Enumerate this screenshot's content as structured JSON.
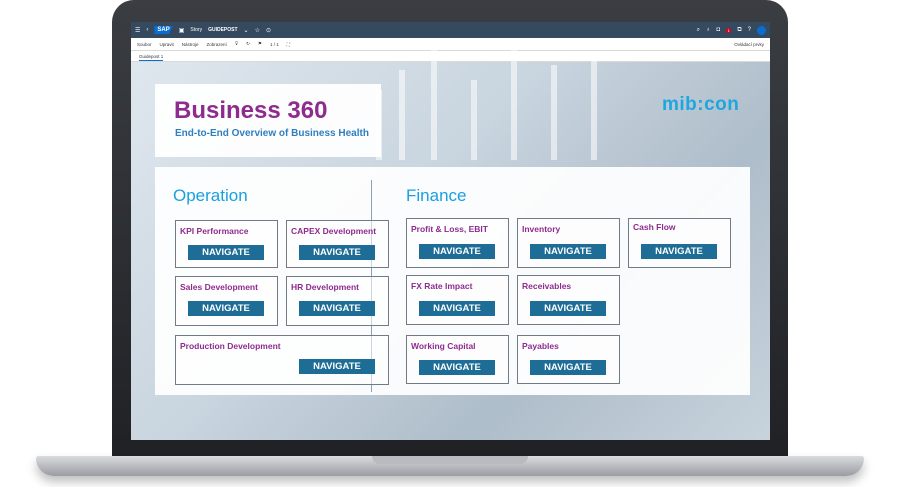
{
  "shell": {
    "logo": "SAP",
    "app": "Story",
    "story_name": "GUIDEPOST",
    "notification_count": "1",
    "icons": [
      "menu-icon",
      "back-icon",
      "story-icon",
      "star-icon",
      "edit-icon",
      "search-icon",
      "lightbulb-icon",
      "bell-icon",
      "copy-icon",
      "help-icon",
      "user-icon"
    ]
  },
  "toolbar": {
    "menus": [
      "Soubor",
      "Upravit",
      "Nástroje",
      "Zobrazení"
    ],
    "page_indicator": "1 / 1",
    "right_label": "Ovládací prvky"
  },
  "tabs": [
    {
      "label": "Guidepost 1"
    }
  ],
  "header": {
    "title": "Business 360",
    "subtitle": "End-to-End Overview of Business Health",
    "brand": "mib:con"
  },
  "operation": {
    "title": "Operation",
    "cards": [
      {
        "label": "KPI Performance",
        "button": "NAVIGATE"
      },
      {
        "label": "CAPEX Development",
        "button": "NAVIGATE"
      },
      {
        "label": "Sales Development",
        "button": "NAVIGATE"
      },
      {
        "label": "HR Development",
        "button": "NAVIGATE"
      },
      {
        "label": "Production Development",
        "button": "NAVIGATE"
      }
    ]
  },
  "finance": {
    "title": "Finance",
    "cards": [
      {
        "label": "Profit & Loss, EBIT",
        "button": "NAVIGATE"
      },
      {
        "label": "Inventory",
        "button": "NAVIGATE"
      },
      {
        "label": "Cash Flow",
        "button": "NAVIGATE"
      },
      {
        "label": "FX Rate Impact",
        "button": "NAVIGATE"
      },
      {
        "label": "Receivables",
        "button": "NAVIGATE"
      },
      {
        "label": "Working Capital",
        "button": "NAVIGATE"
      },
      {
        "label": "Payables",
        "button": "NAVIGATE"
      }
    ]
  },
  "colors": {
    "shellbar": "#354a5f",
    "title": "#8e2b8e",
    "accent": "#1aa0e0",
    "button": "#1d6d96"
  }
}
